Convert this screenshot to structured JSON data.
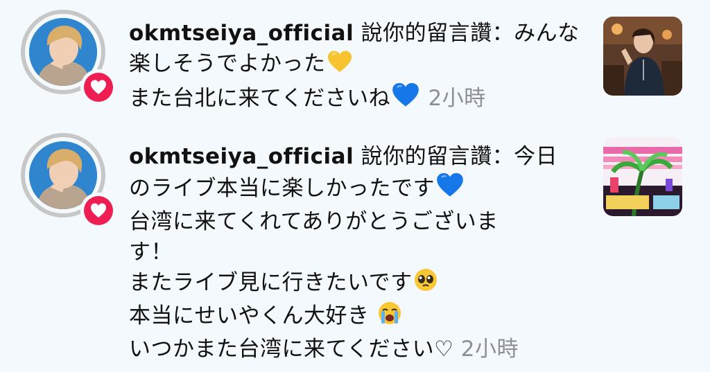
{
  "notifications": [
    {
      "username": "okmtseiya_official",
      "action": " 說你的留言讚：",
      "lines": [
        "みんな楽しそうでよかった",
        "また台北に来てくださいね"
      ],
      "timestamp": "2小時",
      "icons": [
        "avatar-photo",
        "heart-icon",
        "yellow-heart-emoji",
        "blue-heart-emoji",
        "post-thumbnail-photo"
      ]
    },
    {
      "username": "okmtseiya_official",
      "action": " 說你的留言讚：",
      "lines": [
        "今日",
        "のライブ本当に楽しかったです",
        "台湾に来てくれてありがとうございま",
        "す！",
        "またライブ見に行きたいです",
        "本当にせいやくん大好き",
        "いつかまた台湾に来てください♡"
      ],
      "timestamp": "2小時",
      "icons": [
        "avatar-photo",
        "heart-icon",
        "blue-heart-emoji",
        "pleading-face-emoji",
        "loudly-crying-face-emoji",
        "post-thumbnail-artwork"
      ]
    }
  ],
  "colors": {
    "background": "#f4f9fd",
    "heart_badge": "#ee1d52",
    "timestamp": "#8e8e93",
    "avatar_ring": "#c7c7c7"
  }
}
